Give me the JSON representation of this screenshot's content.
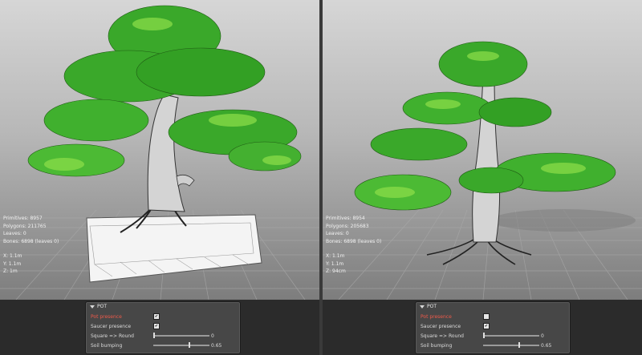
{
  "viewports": [
    {
      "stats": {
        "primitives": "Primitives: 8957",
        "polygons": "Polygons: 211765",
        "leaves": "Leaves: 0",
        "bones": "Bones: 6898 (leaves 0)",
        "x": "X: 1.1m",
        "y": "Y: 1.1m",
        "z": "Z: 1m"
      },
      "pot_panel": {
        "title": "POT",
        "pot_presence": {
          "label": "Pot presence",
          "checked": true,
          "mark": "✔"
        },
        "saucer_presence": {
          "label": "Saucer presence",
          "checked": true,
          "mark": "✔"
        },
        "square_round": {
          "label": "Square => Round",
          "value": "0",
          "fraction": 0.0
        },
        "soil_bumping": {
          "label": "Soil bumping",
          "value": "0.65",
          "fraction": 0.65
        }
      }
    },
    {
      "stats": {
        "primitives": "Primitives: 8954",
        "polygons": "Polygons: 205683",
        "leaves": "Leaves: 0",
        "bones": "Bones: 6898 (leaves 0)",
        "x": "X: 1.1m",
        "y": "Y: 1.1m",
        "z": "Z: 94cm"
      },
      "pot_panel": {
        "title": "POT",
        "pot_presence": {
          "label": "Pot presence",
          "checked": false,
          "mark": ""
        },
        "saucer_presence": {
          "label": "Saucer presence",
          "checked": true,
          "mark": "✔"
        },
        "square_round": {
          "label": "Square => Round",
          "value": "0",
          "fraction": 0.0
        },
        "soil_bumping": {
          "label": "Soil bumping",
          "value": "0.65",
          "fraction": 0.65
        }
      }
    }
  ],
  "colors": {
    "foliage": "#3aa82a",
    "foliage_light": "#8fe04a",
    "trunk": "#d9d9d9",
    "wire": "#3a3a3a",
    "grid": "#9a9a9a",
    "pot": "#f4f4f4",
    "active_label": "#f05a4a"
  }
}
